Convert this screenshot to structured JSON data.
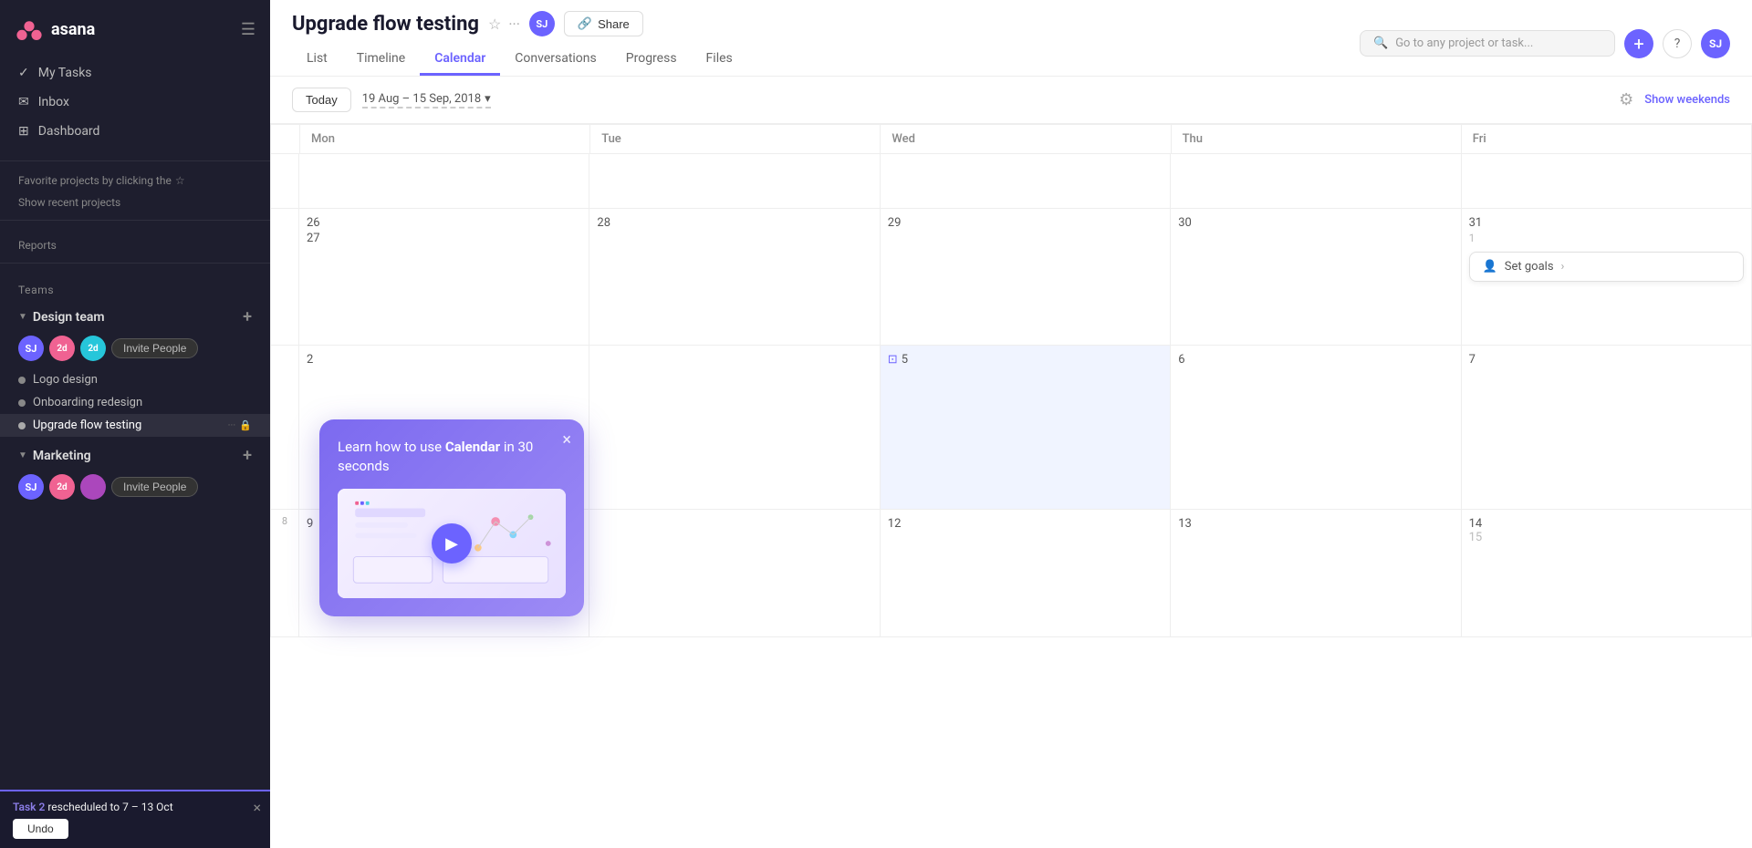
{
  "sidebar": {
    "logo_text": "asana",
    "nav_items": [
      {
        "label": "My Tasks",
        "id": "my-tasks"
      },
      {
        "label": "Inbox",
        "id": "inbox"
      },
      {
        "label": "Dashboard",
        "id": "dashboard"
      }
    ],
    "fav_hint": "Favorite projects by clicking the",
    "fav_icon": "☆",
    "show_recent": "Show recent projects",
    "reports": "Reports",
    "teams_label": "Teams",
    "design_team": {
      "name": "Design team",
      "projects": [
        {
          "label": "Logo design",
          "active": false
        },
        {
          "label": "Onboarding redesign",
          "active": false
        },
        {
          "label": "Upgrade flow testing",
          "active": true
        }
      ]
    },
    "marketing_team": {
      "name": "Marketing"
    },
    "invite_label": "Invite People"
  },
  "topbar": {
    "project_title": "Upgrade flow testing",
    "share_label": "Share",
    "tabs": [
      "List",
      "Timeline",
      "Calendar",
      "Conversations",
      "Progress",
      "Files"
    ],
    "active_tab": "Calendar",
    "search_placeholder": "Go to any project or task...",
    "user_initials": "SJ"
  },
  "calendar": {
    "today_label": "Today",
    "date_range": "19 Aug – 15 Sep, 2018",
    "show_weekends": "Show weekends",
    "headers": [
      "Mon",
      "Tue",
      "Wed",
      "Thu",
      "Fri"
    ],
    "weeks": [
      {
        "side": "",
        "days": [
          {
            "num": "",
            "shaded": false
          },
          {
            "num": "",
            "shaded": false
          },
          {
            "num": "",
            "shaded": false
          },
          {
            "num": "",
            "shaded": false
          },
          {
            "num": "",
            "shaded": false
          }
        ]
      },
      {
        "side": "",
        "days": [
          {
            "num": "26",
            "shaded": false,
            "extra": "27"
          },
          {
            "num": "28",
            "shaded": false
          },
          {
            "num": "29",
            "shaded": false
          },
          {
            "num": "30",
            "shaded": false
          },
          {
            "num": "31",
            "shaded": false,
            "event": "1",
            "has_set_goals": true
          }
        ]
      },
      {
        "side": "",
        "days": [
          {
            "num": "2",
            "shaded": false
          },
          {
            "num": "",
            "shaded": false
          },
          {
            "num": "5",
            "shaded": true,
            "has_task_icon": true
          },
          {
            "num": "6",
            "shaded": false
          },
          {
            "num": "7",
            "shaded": false
          }
        ]
      },
      {
        "side": "8",
        "days": [
          {
            "num": "9",
            "shaded": false
          },
          {
            "num": "",
            "shaded": false
          },
          {
            "num": "12",
            "shaded": false
          },
          {
            "num": "13",
            "shaded": false
          },
          {
            "num": "14",
            "shaded": false,
            "extra_right": "15"
          }
        ]
      }
    ]
  },
  "video_popup": {
    "title_prefix": "Learn how to use ",
    "title_keyword": "Calendar",
    "title_suffix": " in 30 seconds",
    "close_icon": "×"
  },
  "notification": {
    "task_label": "Task 2",
    "message": " rescheduled to 7 – 13 Oct",
    "undo_label": "Undo"
  }
}
